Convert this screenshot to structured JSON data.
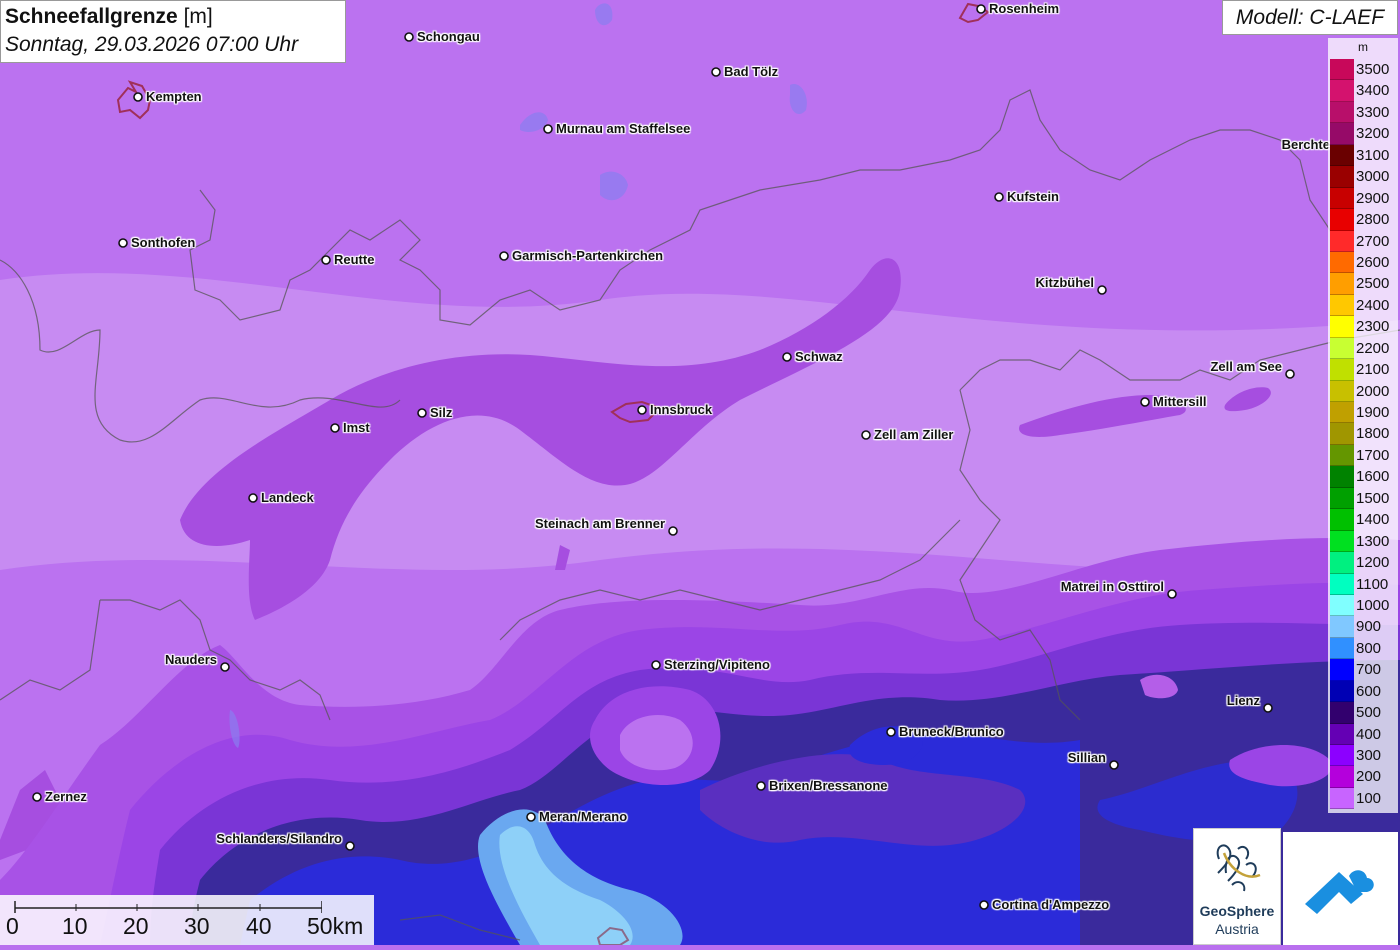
{
  "title": {
    "main": "Schneefallgrenze",
    "unit": "[m]",
    "date": "Sonntag, 29.03.2026 07:00 Uhr"
  },
  "model": "Modell: C-LAEF",
  "legend": {
    "unit": "m",
    "entries": [
      {
        "label": "3500",
        "color": "#c8085a"
      },
      {
        "label": "3400",
        "color": "#d4126e"
      },
      {
        "label": "3300",
        "color": "#b80f6a"
      },
      {
        "label": "3200",
        "color": "#960a68"
      },
      {
        "label": "3100",
        "color": "#6a0000"
      },
      {
        "label": "3000",
        "color": "#9a0000"
      },
      {
        "label": "2900",
        "color": "#c80000"
      },
      {
        "label": "2800",
        "color": "#e80000"
      },
      {
        "label": "2700",
        "color": "#ff2a2a"
      },
      {
        "label": "2600",
        "color": "#ff6a00"
      },
      {
        "label": "2500",
        "color": "#ff9e00"
      },
      {
        "label": "2400",
        "color": "#ffc800"
      },
      {
        "label": "2300",
        "color": "#ffff00"
      },
      {
        "label": "2200",
        "color": "#c8ff32"
      },
      {
        "label": "2100",
        "color": "#c0e000"
      },
      {
        "label": "2000",
        "color": "#c8c000"
      },
      {
        "label": "1900",
        "color": "#c0a000"
      },
      {
        "label": "1800",
        "color": "#a09600"
      },
      {
        "label": "1700",
        "color": "#649600"
      },
      {
        "label": "1600",
        "color": "#008200"
      },
      {
        "label": "1500",
        "color": "#00a000"
      },
      {
        "label": "1400",
        "color": "#00c000"
      },
      {
        "label": "1300",
        "color": "#00e020"
      },
      {
        "label": "1200",
        "color": "#00f080"
      },
      {
        "label": "1100",
        "color": "#00ffc0"
      },
      {
        "label": "1000",
        "color": "#80ffff"
      },
      {
        "label": "900",
        "color": "#80c8ff"
      },
      {
        "label": "800",
        "color": "#3090ff"
      },
      {
        "label": "700",
        "color": "#0000ff"
      },
      {
        "label": "600",
        "color": "#0000b4"
      },
      {
        "label": "500",
        "color": "#32006e"
      },
      {
        "label": "400",
        "color": "#6400b4"
      },
      {
        "label": "300",
        "color": "#8c00ff"
      },
      {
        "label": "200",
        "color": "#b400dc"
      },
      {
        "label": "100",
        "color": "#c864ff"
      }
    ]
  },
  "cities": [
    {
      "name": "Schongau"
    },
    {
      "name": "Rosenheim"
    },
    {
      "name": "Kempten"
    },
    {
      "name": "Bad Tölz"
    },
    {
      "name": "Murnau am Staffelsee"
    },
    {
      "name": "Berchte"
    },
    {
      "name": "Kufstein"
    },
    {
      "name": "Sonthofen"
    },
    {
      "name": "Reutte"
    },
    {
      "name": "Garmisch-Partenkirchen"
    },
    {
      "name": "Kitzbühel"
    },
    {
      "name": "Schwaz"
    },
    {
      "name": "Zell am See"
    },
    {
      "name": "Mittersill"
    },
    {
      "name": "Imst"
    },
    {
      "name": "Silz"
    },
    {
      "name": "Innsbruck"
    },
    {
      "name": "Zell am Ziller"
    },
    {
      "name": "Landeck"
    },
    {
      "name": "Steinach am Brenner"
    },
    {
      "name": "Matrei in Osttirol"
    },
    {
      "name": "Nauders"
    },
    {
      "name": "Sterzing/Vipiteno"
    },
    {
      "name": "Lienz"
    },
    {
      "name": "Bruneck/Brunico"
    },
    {
      "name": "Sillian"
    },
    {
      "name": "Brixen/Bressanone"
    },
    {
      "name": "Zernez"
    },
    {
      "name": "Meran/Merano"
    },
    {
      "name": "Schlanders/Silandro"
    },
    {
      "name": "Cortina d'Ampezzo"
    }
  ],
  "scale": {
    "labels": [
      "0",
      "10",
      "20",
      "30",
      "40",
      "50km"
    ]
  },
  "logos": {
    "geosphere_name": "GeoSphere",
    "geosphere_sub": "Austria"
  }
}
